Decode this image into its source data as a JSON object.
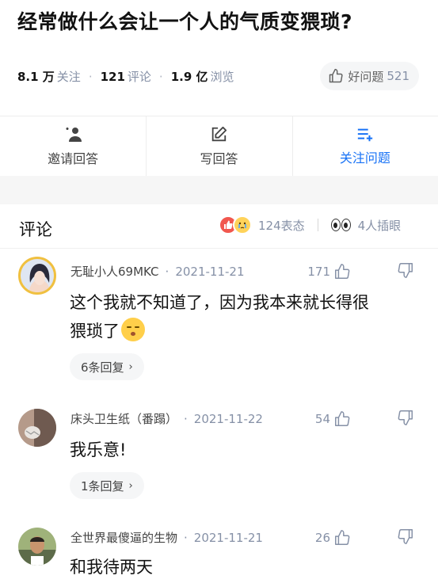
{
  "question": {
    "title": "经常做什么会让一个人的气质变猥琐?",
    "followers_num": "8.1 万",
    "followers_label": "关注",
    "comments_num": "121",
    "comments_label": "评论",
    "views_num": "1.9 亿",
    "views_label": "浏览",
    "good_question_label": "好问题",
    "good_question_count": "521"
  },
  "actions": {
    "invite_label": "邀请回答",
    "write_label": "写回答",
    "follow_label": "关注问题"
  },
  "comments_header": {
    "title": "评论",
    "reactions_count": "124表态",
    "watchers_count": "4人插眼"
  },
  "comments": [
    {
      "author": "无耻小人69MKC",
      "date": "2021-11-21",
      "likes": "171",
      "text_line1": "这个我就不知道了，因为我本来就长得很",
      "text_line2": "猥琐了",
      "replies": "6条回复"
    },
    {
      "author": "床头卫生纸（番蹋）",
      "date": "2021-11-22",
      "likes": "54",
      "text": "我乐意!",
      "replies": "1条回复"
    },
    {
      "author": "全世界最傻逼的生物",
      "date": "2021-11-21",
      "likes": "26",
      "text": "和我待两天"
    }
  ],
  "common": {
    "dot": "·",
    "chevron": "›"
  },
  "colors": {
    "accent": "#1772f6",
    "muted": "#8590a6",
    "like_red": "#f1574e"
  }
}
